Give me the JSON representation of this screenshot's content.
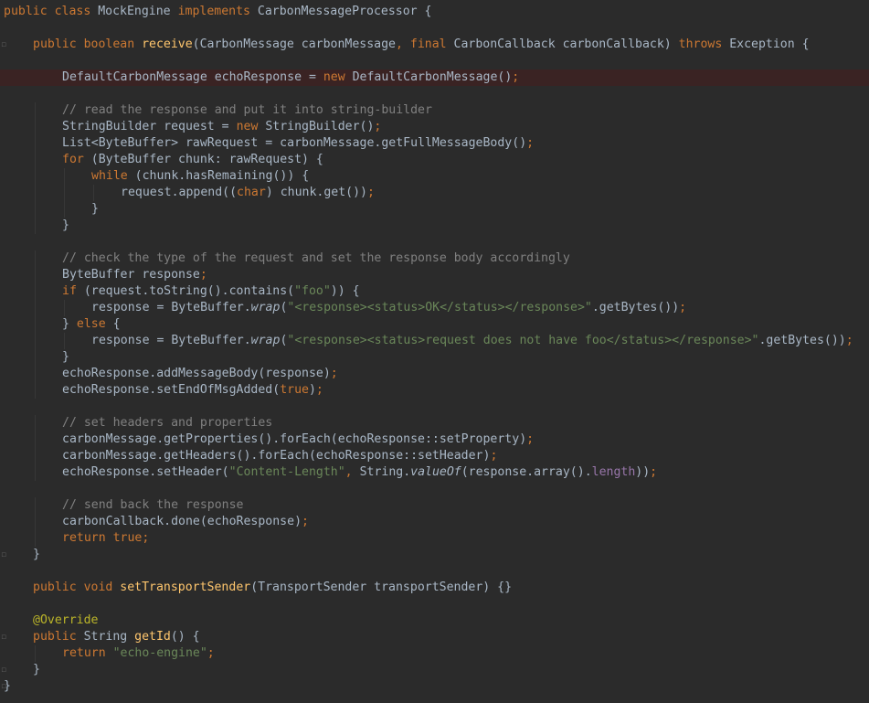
{
  "editor": {
    "colors": {
      "background": "#2b2b2b",
      "default": "#a9b7c6",
      "keyword": "#cc7832",
      "method": "#ffc66d",
      "string": "#6a8759",
      "comment": "#808080",
      "annotation": "#bbb529",
      "field": "#9876aa",
      "highlight_line": "#3a2323"
    },
    "lines": [
      {
        "indent": 0,
        "tokens": [
          [
            "public class ",
            "kw"
          ],
          [
            "MockEngine ",
            ""
          ],
          [
            "implements ",
            "kw"
          ],
          [
            "CarbonMessageProcessor {",
            ""
          ]
        ]
      },
      {
        "indent": 0,
        "tokens": []
      },
      {
        "indent": 1,
        "tokens": [
          [
            "public boolean ",
            "kw"
          ],
          [
            "receive",
            "fn"
          ],
          [
            "(CarbonMessage carbonMessage",
            ""
          ],
          [
            ", ",
            "kw"
          ],
          [
            "final ",
            "kw"
          ],
          [
            "CarbonCallback carbonCallback) ",
            ""
          ],
          [
            "throws ",
            "kw"
          ],
          [
            "Exception {",
            ""
          ]
        ]
      },
      {
        "indent": 0,
        "tokens": []
      },
      {
        "indent": 2,
        "highlight": true,
        "tokens": [
          [
            "DefaultCarbonMessage echoResponse = ",
            ""
          ],
          [
            "new ",
            "kw"
          ],
          [
            "DefaultCarbonMessage()",
            ""
          ],
          [
            ";",
            "kw"
          ]
        ]
      },
      {
        "indent": 0,
        "tokens": []
      },
      {
        "indent": 2,
        "tokens": [
          [
            "// read the response and put it into string-builder",
            "cm"
          ]
        ]
      },
      {
        "indent": 2,
        "tokens": [
          [
            "StringBuilder request = ",
            ""
          ],
          [
            "new ",
            "kw"
          ],
          [
            "StringBuilder()",
            ""
          ],
          [
            ";",
            "kw"
          ]
        ]
      },
      {
        "indent": 2,
        "tokens": [
          [
            "List<ByteBuffer> rawRequest = carbonMessage.getFullMessageBody()",
            ""
          ],
          [
            ";",
            "kw"
          ]
        ]
      },
      {
        "indent": 2,
        "tokens": [
          [
            "for ",
            "kw"
          ],
          [
            "(ByteBuffer chunk: rawRequest) {",
            ""
          ]
        ]
      },
      {
        "indent": 3,
        "tokens": [
          [
            "while ",
            "kw"
          ],
          [
            "(chunk.hasRemaining()) {",
            ""
          ]
        ]
      },
      {
        "indent": 4,
        "tokens": [
          [
            "request.append((",
            ""
          ],
          [
            "char",
            "kw"
          ],
          [
            ") chunk.get())",
            ""
          ],
          [
            ";",
            "kw"
          ]
        ]
      },
      {
        "indent": 3,
        "tokens": [
          [
            "}",
            ""
          ]
        ]
      },
      {
        "indent": 2,
        "tokens": [
          [
            "}",
            ""
          ]
        ]
      },
      {
        "indent": 0,
        "tokens": []
      },
      {
        "indent": 2,
        "tokens": [
          [
            "// check the type of the request and set the response body accordingly",
            "cm"
          ]
        ]
      },
      {
        "indent": 2,
        "tokens": [
          [
            "ByteBuffer response",
            ""
          ],
          [
            ";",
            "kw"
          ]
        ]
      },
      {
        "indent": 2,
        "tokens": [
          [
            "if ",
            "kw"
          ],
          [
            "(request.toString().contains(",
            ""
          ],
          [
            "\"foo\"",
            "str"
          ],
          [
            ")) {",
            ""
          ]
        ]
      },
      {
        "indent": 3,
        "tokens": [
          [
            "response = ByteBuffer.",
            ""
          ],
          [
            "wrap",
            "it"
          ],
          [
            "(",
            ""
          ],
          [
            "\"<response><status>OK</status></response>\"",
            "str"
          ],
          [
            ".getBytes())",
            ""
          ],
          [
            ";",
            "kw"
          ]
        ]
      },
      {
        "indent": 2,
        "tokens": [
          [
            "} ",
            ""
          ],
          [
            "else ",
            "kw"
          ],
          [
            "{",
            ""
          ]
        ]
      },
      {
        "indent": 3,
        "tokens": [
          [
            "response = ByteBuffer.",
            ""
          ],
          [
            "wrap",
            "it"
          ],
          [
            "(",
            ""
          ],
          [
            "\"<response><status>request does not have foo</status></response>\"",
            "str"
          ],
          [
            ".getBytes())",
            ""
          ],
          [
            ";",
            "kw"
          ]
        ]
      },
      {
        "indent": 2,
        "tokens": [
          [
            "}",
            ""
          ]
        ]
      },
      {
        "indent": 2,
        "tokens": [
          [
            "echoResponse.addMessageBody(response)",
            ""
          ],
          [
            ";",
            "kw"
          ]
        ]
      },
      {
        "indent": 2,
        "tokens": [
          [
            "echoResponse.setEndOfMsgAdded(",
            ""
          ],
          [
            "true",
            "kw"
          ],
          [
            ")",
            ""
          ],
          [
            ";",
            "kw"
          ]
        ]
      },
      {
        "indent": 0,
        "tokens": []
      },
      {
        "indent": 2,
        "tokens": [
          [
            "// set headers and properties",
            "cm"
          ]
        ]
      },
      {
        "indent": 2,
        "tokens": [
          [
            "carbonMessage.getProperties().forEach(echoResponse::setProperty)",
            ""
          ],
          [
            ";",
            "kw"
          ]
        ]
      },
      {
        "indent": 2,
        "tokens": [
          [
            "carbonMessage.getHeaders().forEach(echoResponse::setHeader)",
            ""
          ],
          [
            ";",
            "kw"
          ]
        ]
      },
      {
        "indent": 2,
        "tokens": [
          [
            "echoResponse.setHeader(",
            ""
          ],
          [
            "\"Content-Length\"",
            "str"
          ],
          [
            ", ",
            "kw"
          ],
          [
            "String.",
            ""
          ],
          [
            "valueOf",
            "it"
          ],
          [
            "(response.array().",
            ""
          ],
          [
            "length",
            "fld"
          ],
          [
            "))",
            ""
          ],
          [
            ";",
            "kw"
          ]
        ]
      },
      {
        "indent": 0,
        "tokens": []
      },
      {
        "indent": 2,
        "tokens": [
          [
            "// send back the response",
            "cm"
          ]
        ]
      },
      {
        "indent": 2,
        "tokens": [
          [
            "carbonCallback.done(echoResponse)",
            ""
          ],
          [
            ";",
            "kw"
          ]
        ]
      },
      {
        "indent": 2,
        "tokens": [
          [
            "return true",
            "kw"
          ],
          [
            ";",
            "kw"
          ]
        ]
      },
      {
        "indent": 1,
        "tokens": [
          [
            "}",
            ""
          ]
        ]
      },
      {
        "indent": 0,
        "tokens": []
      },
      {
        "indent": 1,
        "tokens": [
          [
            "public void ",
            "kw"
          ],
          [
            "setTransportSender",
            "fn"
          ],
          [
            "(TransportSender transportSender) {}",
            ""
          ]
        ]
      },
      {
        "indent": 0,
        "tokens": []
      },
      {
        "indent": 1,
        "tokens": [
          [
            "@Override",
            "an"
          ]
        ]
      },
      {
        "indent": 1,
        "tokens": [
          [
            "public ",
            "kw"
          ],
          [
            "String ",
            ""
          ],
          [
            "getId",
            "fn"
          ],
          [
            "() {",
            ""
          ]
        ]
      },
      {
        "indent": 2,
        "tokens": [
          [
            "return ",
            "kw"
          ],
          [
            "\"echo-engine\"",
            "str"
          ],
          [
            ";",
            "kw"
          ]
        ]
      },
      {
        "indent": 1,
        "tokens": [
          [
            "}",
            ""
          ]
        ]
      },
      {
        "indent": 0,
        "tokens": [
          [
            "}",
            ""
          ]
        ]
      }
    ]
  }
}
